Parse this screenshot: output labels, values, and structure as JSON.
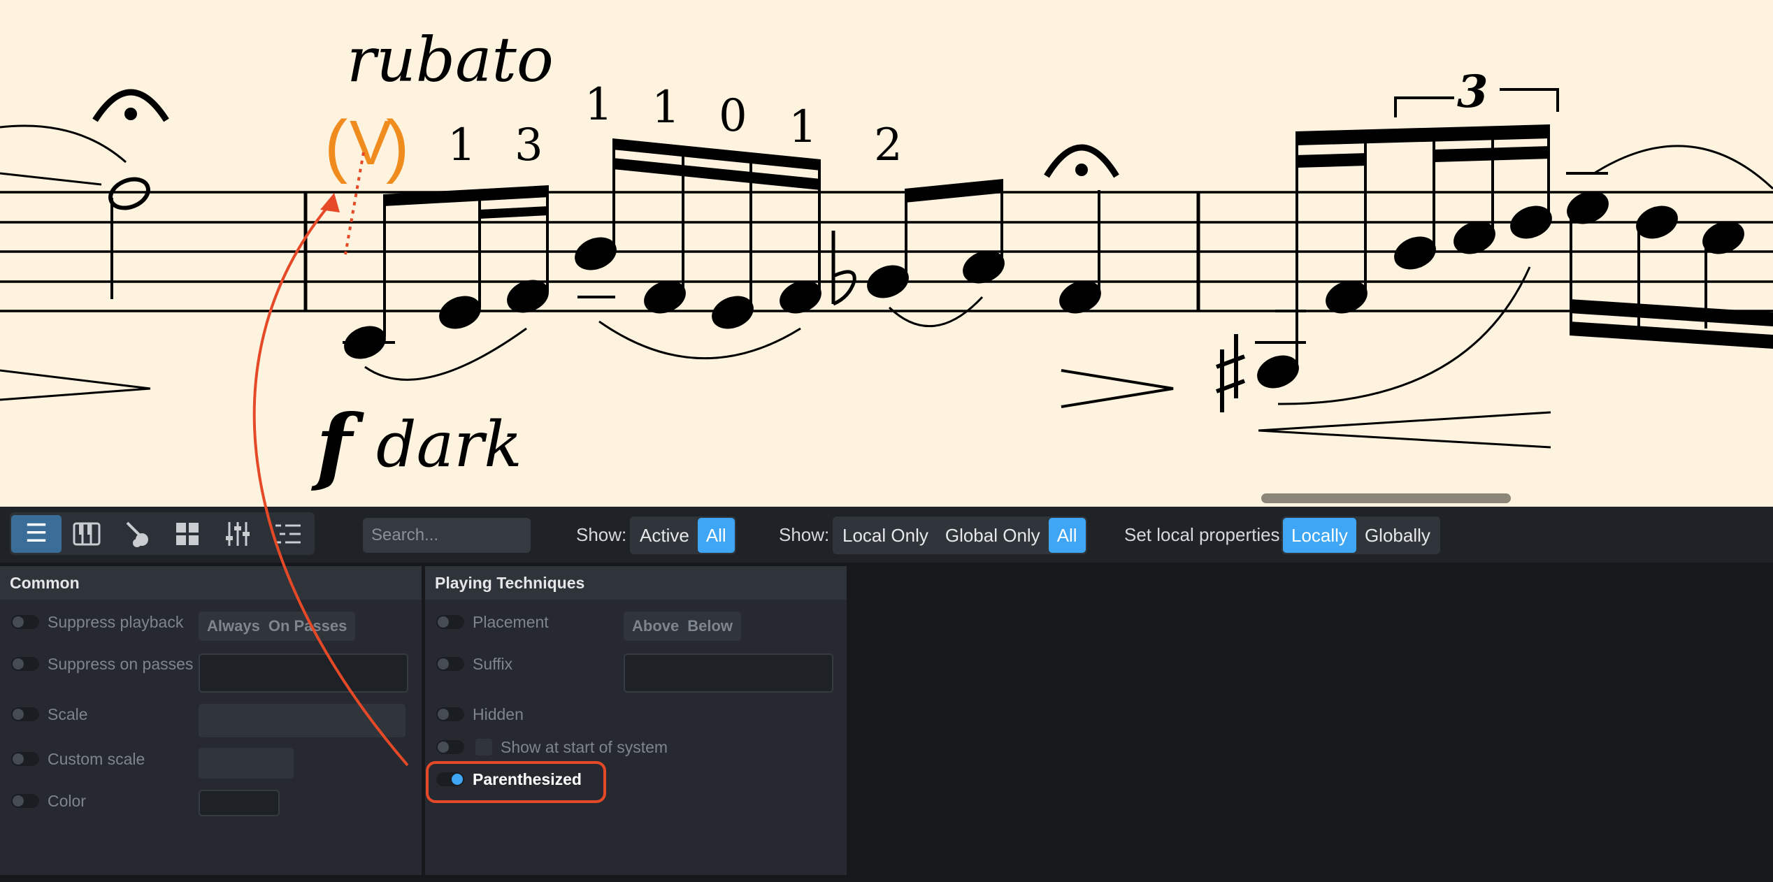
{
  "score": {
    "tempo_text": "rubato",
    "dynamic_mark": "f",
    "dynamic_text": "dark",
    "technique_paren_open": "(",
    "technique_symbol": "V",
    "technique_paren_close": ")",
    "fingerings": [
      "1",
      "3",
      "1",
      "1",
      "0",
      "1",
      "2"
    ],
    "tuplet_number": "3",
    "colors": {
      "paper": "#fef3de",
      "technique": "#f08c1e",
      "annotation_arrow": "#e54928"
    }
  },
  "toolbar": {
    "tabs": [
      {
        "icon": "list-icon",
        "active": true
      },
      {
        "icon": "piano-keys-icon",
        "active": false
      },
      {
        "icon": "guitar-icon",
        "active": false
      },
      {
        "icon": "grid-icon",
        "active": false
      },
      {
        "icon": "mixer-sliders-icon",
        "active": false
      },
      {
        "icon": "checklist-icon",
        "active": false
      }
    ],
    "search_placeholder": "Search...",
    "show1_label": "Show:",
    "show1_options": [
      "Active",
      "All"
    ],
    "show1_selected": "All",
    "show2_label": "Show:",
    "show2_options": [
      "Local Only",
      "Global Only",
      "All"
    ],
    "show2_selected": "All",
    "local_props_label": "Set local properties:",
    "local_props_options": [
      "Locally",
      "Globally"
    ],
    "local_props_selected": "Locally",
    "accent_color": "#3ea6f5"
  },
  "common": {
    "title": "Common",
    "suppress_playback": "Suppress playback",
    "suppress_options": [
      "Always",
      "On Passes"
    ],
    "suppress_on_passes": "Suppress on passes",
    "scale": "Scale",
    "custom_scale": "Custom scale",
    "color": "Color"
  },
  "playing": {
    "title": "Playing Techniques",
    "placement": "Placement",
    "placement_options": [
      "Above",
      "Below"
    ],
    "suffix": "Suffix",
    "hidden": "Hidden",
    "show_at_start": "Show at start of system",
    "parenthesized": "Parenthesized",
    "parenthesized_on": true
  }
}
